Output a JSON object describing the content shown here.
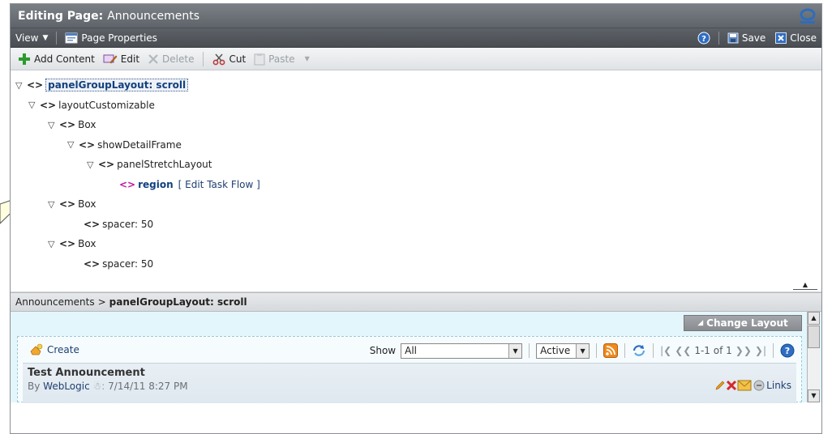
{
  "titlebar": {
    "label": "Editing Page:",
    "page_name": "Announcements"
  },
  "menubar": {
    "view_label": "View",
    "page_properties_label": "Page Properties",
    "save_label": "Save",
    "close_label": "Close"
  },
  "toolbar": {
    "add_content_label": "Add Content",
    "edit_label": "Edit",
    "delete_label": "Delete",
    "cut_label": "Cut",
    "paste_label": "Paste"
  },
  "tree": {
    "nodes": [
      {
        "label": "panelGroupLayout: scroll"
      },
      {
        "label": "layoutCustomizable"
      },
      {
        "label": "Box"
      },
      {
        "label": "showDetailFrame"
      },
      {
        "label": "panelStretchLayout"
      },
      {
        "label": "region",
        "action": "[ Edit Task Flow ]"
      },
      {
        "label": "Box"
      },
      {
        "label": "spacer: 50"
      },
      {
        "label": "Box"
      },
      {
        "label": "spacer: 50"
      }
    ]
  },
  "breadcrumb": {
    "root": "Announcements",
    "separator": ">",
    "current": "panelGroupLayout: scroll"
  },
  "preview": {
    "change_layout_label": "Change Layout",
    "create_label": "Create",
    "show_label": "Show",
    "show_value": "All",
    "status_value": "Active",
    "pager_text": "1-1 of 1",
    "announcement": {
      "title": "Test Announcement",
      "by_label": "By",
      "author": "WebLogic",
      "date": "7/14/11 8:27 PM",
      "links_label": "Links"
    }
  },
  "colors": {
    "accent": "#12407e",
    "preview_bg": "#e3f6fb",
    "titlebar": "#6d7278"
  }
}
